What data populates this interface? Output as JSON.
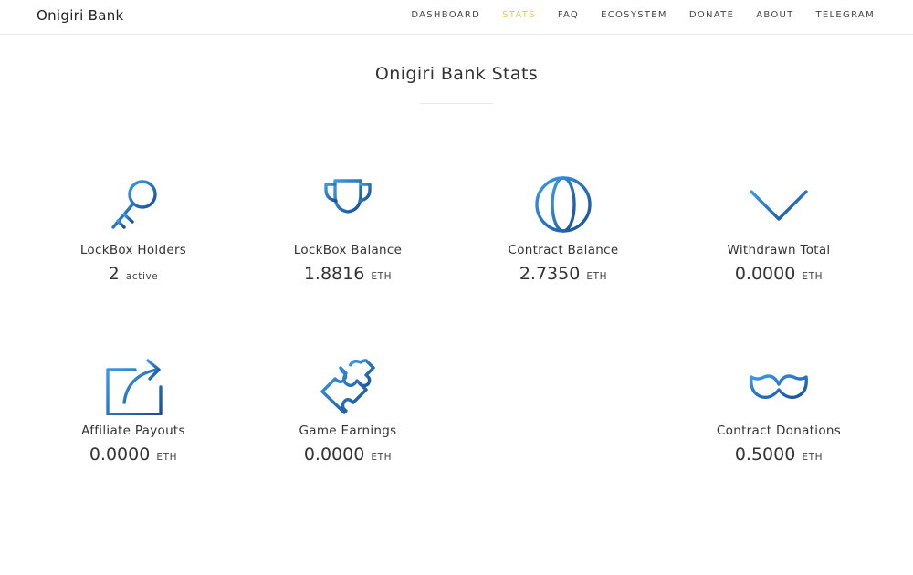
{
  "navbar": {
    "brand": "Onigiri Bank",
    "links": [
      "DASHBOARD",
      "STATS",
      "FAQ",
      "ECOSYSTEM",
      "DONATE",
      "ABOUT",
      "TELEGRAM"
    ],
    "active": "STATS",
    "active_color": "#f3c55a"
  },
  "page": {
    "title": "Onigiri Bank Stats"
  },
  "icon_gradient": {
    "from": "#3a9ae8",
    "to": "#1a4f96"
  },
  "stats": [
    {
      "icon": "key-icon",
      "label": "LockBox Holders",
      "value": "2",
      "unit": "active"
    },
    {
      "icon": "trophy-icon",
      "label": "LockBox Balance",
      "value": "1.8816",
      "unit": "ETH"
    },
    {
      "icon": "globe-icon",
      "label": "Contract Balance",
      "value": "2.7350",
      "unit": "ETH"
    },
    {
      "icon": "chevron-down-icon",
      "label": "Withdrawn Total",
      "value": "0.0000",
      "unit": "ETH"
    },
    {
      "icon": "share-icon",
      "label": "Affiliate Payouts",
      "value": "0.0000",
      "unit": "ETH"
    },
    {
      "icon": "puzzle-icon",
      "label": "Game Earnings",
      "value": "0.0000",
      "unit": "ETH"
    },
    {
      "icon": "mustache-icon",
      "label": "Contract Donations",
      "value": "0.5000",
      "unit": "ETH"
    }
  ]
}
